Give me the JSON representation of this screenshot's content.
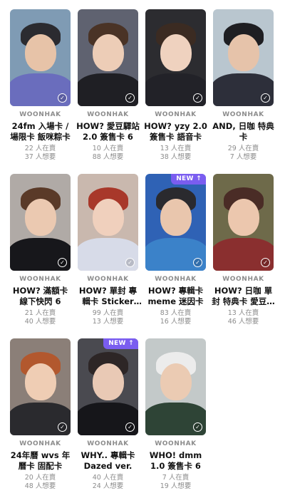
{
  "accent_color": "#7a5df0",
  "cards": [
    {
      "artist": "WOONHAK",
      "title": "24fm 入場卡 / 場限卡 飯咪粽卡",
      "have": "22 人在賣",
      "want": "37 人想要",
      "new_badge": "",
      "collected": true,
      "bg": "#7f9bb4",
      "hair": "#2b2b30",
      "body": "#6a6dbd",
      "skin": "#e7c3a8"
    },
    {
      "artist": "WOONHAK",
      "title": "HOW? 愛豆驛站 2.0 簽售卡 6",
      "have": "10 人在賣",
      "want": "88 人想要",
      "new_badge": "",
      "collected": true,
      "bg": "#5f6270",
      "hair": "#4a3326",
      "body": "#1f1f24",
      "skin": "#edcdb7"
    },
    {
      "artist": "WOONHAK",
      "title": "HOW? yzy 2.0 簽售卡 語音卡",
      "have": "13 人在賣",
      "want": "38 人想要",
      "new_badge": "",
      "collected": true,
      "bg": "#2c2c30",
      "hair": "#3b2b22",
      "body": "#222228",
      "skin": "#efd2bf"
    },
    {
      "artist": "WOONHAK",
      "title": "AND, 日咖 特典卡",
      "have": "29 人在賣",
      "want": "7 人想要",
      "new_badge": "",
      "collected": true,
      "bg": "#b9c6cf",
      "hair": "#1e1e22",
      "body": "#2d2f3a",
      "skin": "#e6c3aa"
    },
    {
      "artist": "WOONHAK",
      "title": "HOW? 滿額卡 線下快閃 6",
      "have": "21 人在賣",
      "want": "40 人想要",
      "new_badge": "",
      "collected": true,
      "bg": "#b0aaa6",
      "hair": "#5a3a28",
      "body": "#17171b",
      "skin": "#ebc9b1"
    },
    {
      "artist": "WOONHAK",
      "title": "HOW? 單封 專輯卡 Sticker ver.",
      "have": "99 人在賣",
      "want": "13 人想要",
      "new_badge": "",
      "collected": true,
      "bg": "#c9b8ae",
      "hair": "#a8382a",
      "body": "#d7dbe8",
      "skin": "#f0d0bd"
    },
    {
      "artist": "WOONHAK",
      "title": "HOW? 專輯卡 meme 迷因卡",
      "have": "83 人在賣",
      "want": "16 人想要",
      "new_badge": "NEW ↑",
      "collected": true,
      "bg": "#2f62b5",
      "hair": "#2a2a2e",
      "body": "#3b82c9",
      "skin": "#e9c6ad"
    },
    {
      "artist": "WOONHAK",
      "title": "HOW? 日咖 單封 特典卡 愛豆驛站",
      "have": "13 人在賣",
      "want": "46 人想要",
      "new_badge": "",
      "collected": true,
      "bg": "#6e6a4a",
      "hair": "#4a2c26",
      "body": "#8a2f2f",
      "skin": "#ecc7ae"
    },
    {
      "artist": "WOONHAK",
      "title": "24年曆 wvs 年曆卡 固配卡",
      "have": "20 人在賣",
      "want": "48 人想要",
      "new_badge": "",
      "collected": true,
      "bg": "#8b7f78",
      "hair": "#b2582e",
      "body": "#2a2a2e",
      "skin": "#efcdb4"
    },
    {
      "artist": "WOONHAK",
      "title": "WHY.. 專輯卡 Dazed ver.",
      "have": "40 人在賣",
      "want": "24 人想要",
      "new_badge": "NEW ↑",
      "collected": true,
      "bg": "#4a4a50",
      "hair": "#2d2626",
      "body": "#16161a",
      "skin": "#e9c9b5"
    },
    {
      "artist": "WOONHAK",
      "title": "WHO! dmm 1.0 簽售卡 6",
      "have": "7 人在賣",
      "want": "19 人想要",
      "new_badge": "",
      "collected": true,
      "bg": "#c3c9c9",
      "hair": "#ececec",
      "body": "#2e4436",
      "skin": "#ebcbb3"
    }
  ]
}
